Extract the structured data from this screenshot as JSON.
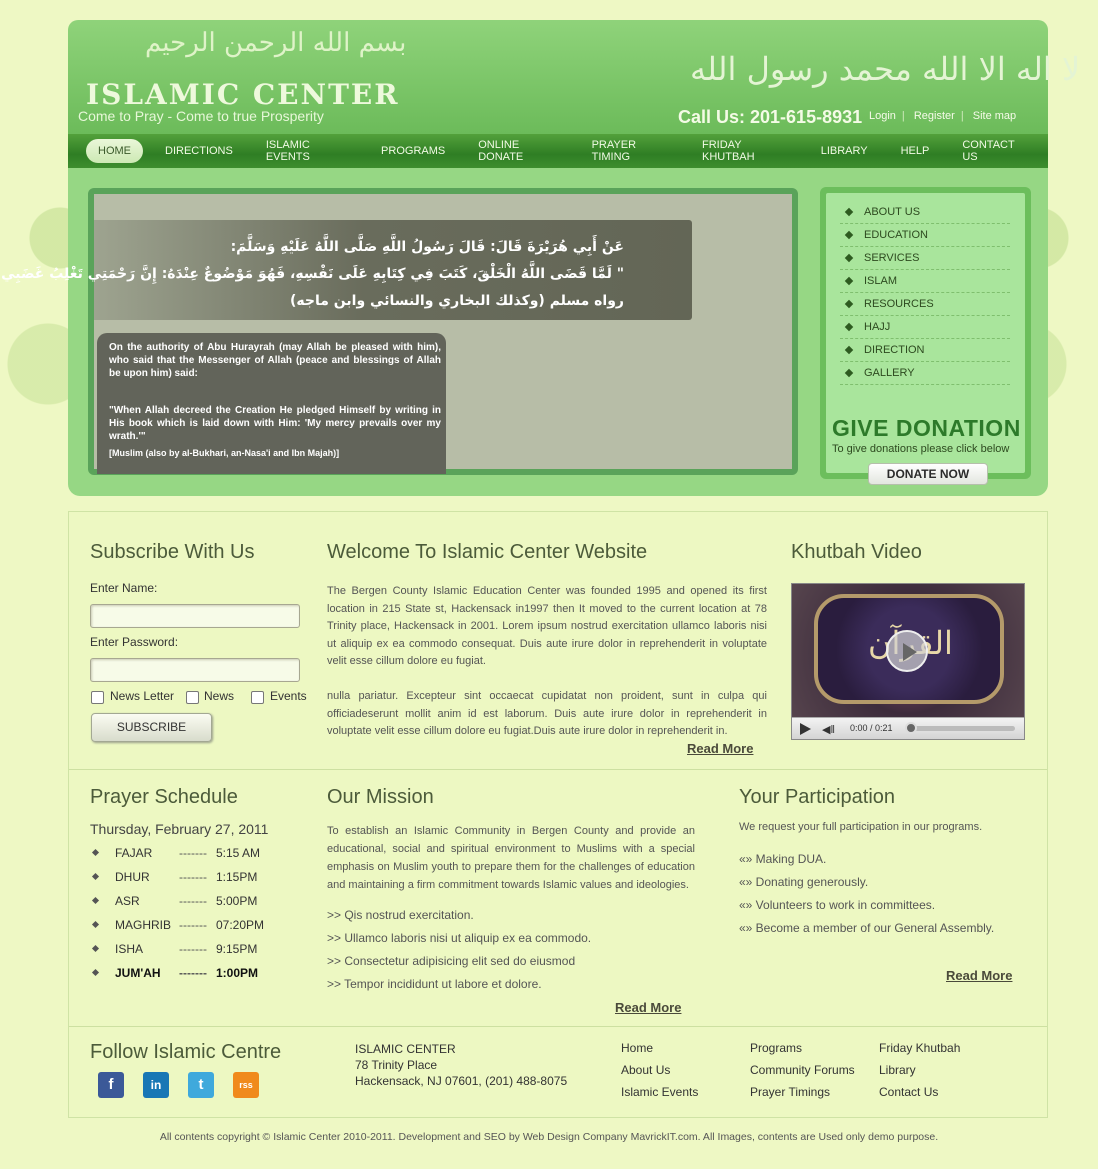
{
  "header": {
    "logo_calligraphy": "بسم الله الرحمن الرحيم",
    "logo_title": "ISLAMIC CENTER",
    "tagline": "Come to Pray - Come to true Prosperity",
    "shahada": "لا اله الا الله محمد رسول الله",
    "phone": "Call Us: 201-615-8931",
    "links": [
      "Login",
      "Register",
      "Site map"
    ]
  },
  "nav": [
    "HOME",
    "DIRECTIONS",
    "ISLAMIC EVENTS",
    "PROGRAMS",
    "ONLINE DONATE",
    "PRAYER TIMING",
    "FRIDAY KHUTBAH",
    "LIBRARY",
    "HELP",
    "CONTACT US"
  ],
  "slider": {
    "arabic_lines": [
      "عَنْ أَبِي هُرَيْرَةَ قَالَ: قَالَ رَسُولُ اللَّهِ صَلَّى اللَّهُ عَلَيْهِ وَسَلَّمَ:",
      "\" لَمَّا قَضَى اللَّهُ الْخَلْقَ، كَتَبَ فِي كِتَابِهِ عَلَى نَفْسِهِ، فَهُوَ مَوْضُوعٌ عِنْدَهُ: إِنَّ رَحْمَتِي تَغْلِبُ غَضَبِي \"",
      "رواه مسلم (وكذلك البخاري والنسائي وابن ماجه)"
    ],
    "attribution": "On the authority of Abu Hurayrah (may Allah be pleased with him), who said that the Messenger of Allah (peace and blessings of Allah be upon him) said:",
    "quote": "\"When Allah decreed the Creation He pledged Himself by writing in His book which is laid down with Him: 'My mercy prevails over my wrath.'\"",
    "reference": "[Muslim (also by al-Bukhari, an-Nasa'i and Ibn Majah)]"
  },
  "sidemenu": {
    "items": [
      "ABOUT US",
      "EDUCATION",
      "SERVICES",
      "ISLAM",
      "RESOURCES",
      "HAJJ",
      "DIRECTION",
      "GALLERY"
    ],
    "donation_title": "GIVE DONATION",
    "donation_sub": "To give donations please click below",
    "donate_button": "DONATE NOW"
  },
  "subscribe": {
    "title": "Subscribe With Us",
    "name_label": "Enter Name:",
    "password_label": "Enter Password:",
    "options": [
      "News Letter",
      "News",
      "Events"
    ],
    "button": "SUBSCRIBE"
  },
  "welcome": {
    "title": "Welcome To Islamic Center Website",
    "p1": "The Bergen County Islamic Education Center was founded 1995 and opened its first location in 215 State st, Hackensack in1997 then It moved to the current location at 78 Trinity place, Hackensack in 2001. Lorem ipsum nostrud exercitation ullamco laboris nisi ut aliquip ex ea commodo consequat. Duis aute irure dolor in reprehenderit in voluptate velit esse cillum dolore eu fugiat.",
    "p2": "nulla pariatur. Excepteur sint occaecat cupidatat non proident, sunt in culpa qui officiadeserunt mollit anim id est laborum. Duis aute irure dolor in reprehenderit in voluptate velit esse cillum dolore eu fugiat.Duis aute irure dolor in reprehenderit in.",
    "read_more": "Read More"
  },
  "video": {
    "title": "Khutbah Video",
    "time": "0:00 / 0:21"
  },
  "prayer": {
    "title": "Prayer Schedule",
    "date": "Thursday, February 27, 2011",
    "rows": [
      {
        "name": "FAJAR",
        "dash": "-------",
        "time": "5:15 AM"
      },
      {
        "name": "DHUR",
        "dash": "-------",
        "time": "1:15PM"
      },
      {
        "name": "ASR",
        "dash": "-------",
        "time": "5:00PM"
      },
      {
        "name": "MAGHRIB",
        "dash": "-------",
        "time": "07:20PM"
      },
      {
        "name": "ISHA",
        "dash": "-------",
        "time": "9:15PM"
      },
      {
        "name": "JUM'AH",
        "dash": "-------",
        "time": "1:00PM"
      }
    ]
  },
  "mission": {
    "title": "Our Mission",
    "text": "To establish an Islamic Community in Bergen County and provide an educational, social and spiritual environment to Muslims with a special emphasis on Muslim youth to prepare them for the challenges of education and maintaining a firm commitment towards Islamic values and ideologies.",
    "items": [
      ">> Qis nostrud exercitation.",
      ">> Ullamco laboris nisi ut aliquip ex ea commodo.",
      ">> Consectetur adipisicing elit sed do eiusmod",
      ">> Tempor incididunt ut labore et dolore."
    ],
    "read_more": "Read More"
  },
  "participation": {
    "title": "Your Participation",
    "intro": "We request your full participation in our programs.",
    "items": [
      "«» Making DUA.",
      "«» Donating generously.",
      "«» Volunteers to work in committees.",
      "«» Become a member of our General Assembly."
    ],
    "read_more": "Read More"
  },
  "footer": {
    "follow_title": "Follow Islamic Centre",
    "social": [
      "f",
      "in",
      "t",
      "rss"
    ],
    "address": [
      "ISLAMIC CENTER",
      "78 Trinity Place",
      "Hackensack, NJ 07601, (201) 488-8075"
    ],
    "links_col1": [
      "Home",
      "About Us",
      "Islamic Events"
    ],
    "links_col2": [
      "Programs",
      "Community Forums",
      "Prayer Timings"
    ],
    "links_col3": [
      "Friday Khutbah",
      "Library",
      "Contact Us"
    ],
    "copyright": "All contents copyright © Islamic Center 2010-2011. Development and SEO by Web Design Company MavrickIT.com. All Images, contents are Used only demo purpose."
  },
  "colors": {
    "header_green": "#7cc86a",
    "nav_green": "#3d8e2e",
    "page_bg": "#eef8c4",
    "donation_green": "#2d7a2a"
  }
}
